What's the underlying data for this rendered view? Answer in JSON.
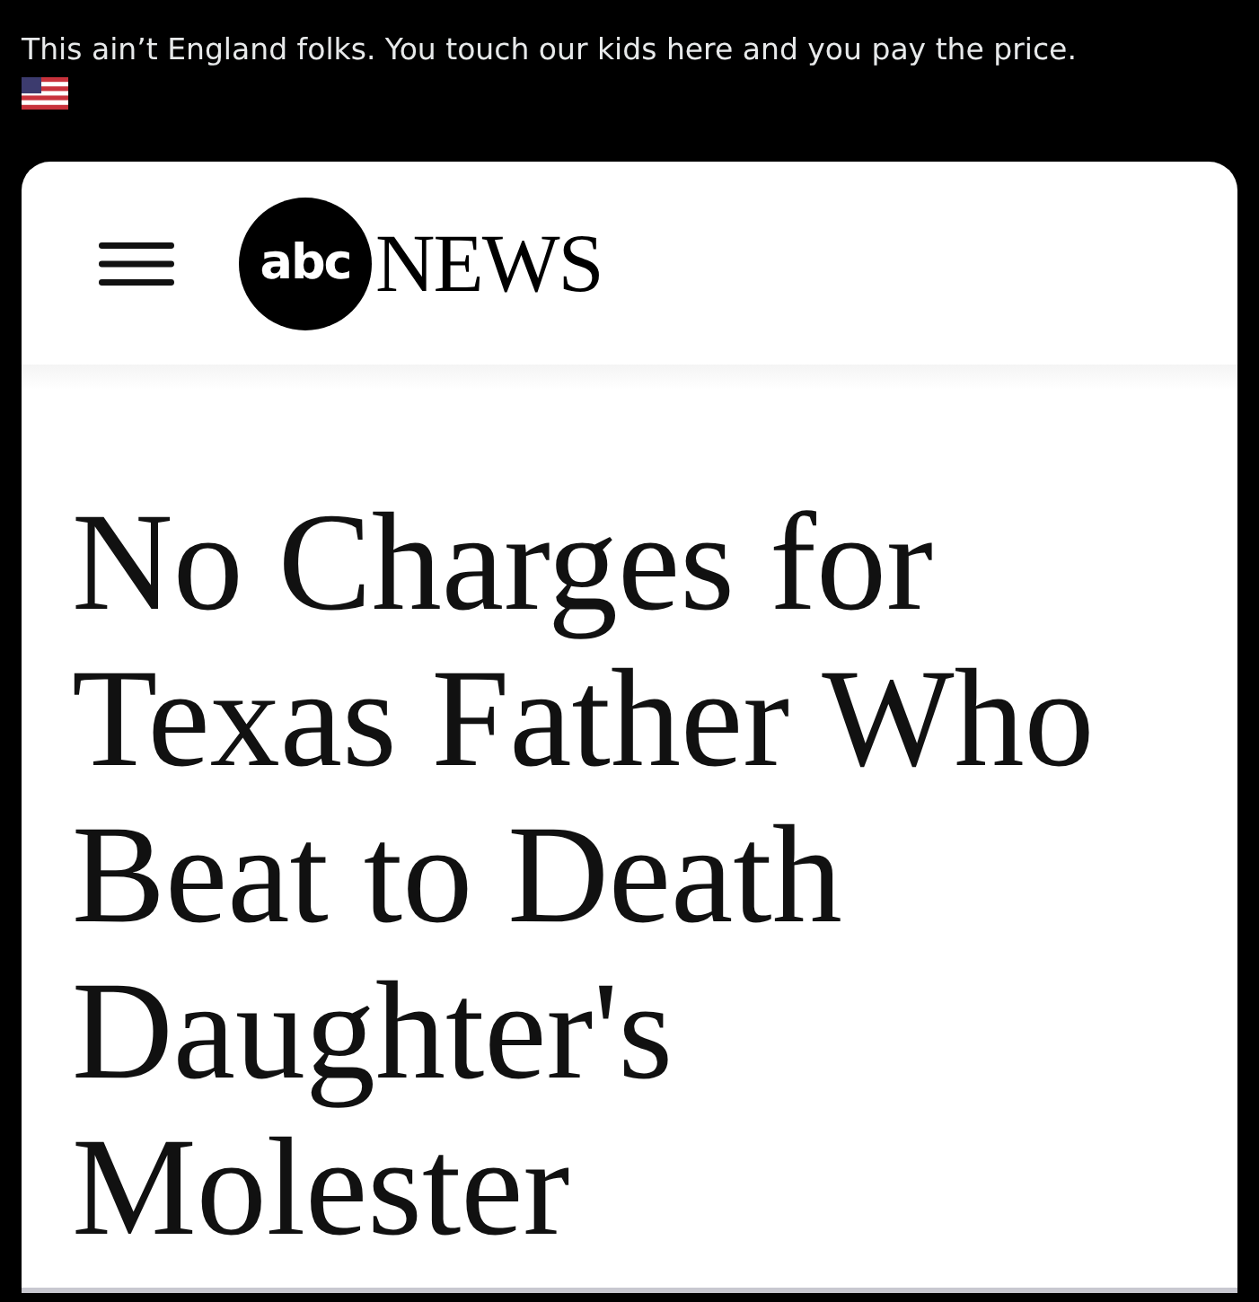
{
  "post": {
    "text": "This ain’t England folks. You touch our kids here and you pay the price."
  },
  "article_card": {
    "logo": {
      "mark": "abc",
      "wordmark": "NEWS"
    },
    "headline_lines": [
      "No Charges for",
      "Texas Father Who",
      "Beat to Death",
      "Daughter's",
      "Molester"
    ]
  }
}
